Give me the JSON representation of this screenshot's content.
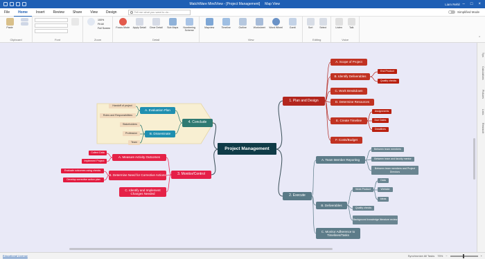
{
  "app": {
    "title": "MatchWare MindView - [Project Management]",
    "context_tab": "Map View",
    "user": "Liam Rehil",
    "search_placeholder": "Tell me what you want to do..."
  },
  "menu": {
    "tabs": [
      "File",
      "Home",
      "Insert",
      "Review",
      "Share",
      "View",
      "Design"
    ],
    "active": "Home",
    "simplified_mode": "Simplified Mode"
  },
  "ribbon": {
    "groups": [
      {
        "name": "Clipboard",
        "buttons": [
          "Paste"
        ]
      },
      {
        "name": "Font",
        "buttons": []
      },
      {
        "name": "Zoom",
        "buttons": [],
        "zoom_items": [
          "100%",
          "Fit All",
          "Full Screen"
        ]
      },
      {
        "name": "Detail",
        "buttons": [
          "Focus Mode",
          "Apply Detail",
          "Clear Detail",
          "Sub Maps",
          "Numbering Scheme"
        ]
      },
      {
        "name": "View",
        "buttons": [
          "Mapview",
          "Timeline",
          "Outline",
          "Worksheet",
          "Word Wheel",
          "Gantt"
        ]
      },
      {
        "name": "Editing",
        "buttons": [
          "Sort",
          "Select"
        ]
      },
      {
        "name": "Voice",
        "buttons": [
          "Listen",
          "Talk",
          "Voice"
        ]
      }
    ]
  },
  "side_panels": [
    "Tips",
    "Calculations",
    "Pictures",
    "Links",
    "Research"
  ],
  "status": {
    "left": "Educational License",
    "sync": "Synchronize All Tasks",
    "zoom": "75%"
  },
  "mindmap": {
    "root": "Project Management",
    "plan": {
      "label": "1. Plan and Design",
      "children": [
        "A. Scope of Project",
        "B. Identify Deliverables",
        "C. Work Breakdown",
        "D. Determine Resources",
        "E. Create Timeline",
        "F. Costs/Budget"
      ],
      "deliverables": [
        "End Product",
        "Quality checks"
      ],
      "timeline": [
        "Assignments",
        "Due Dates",
        "Deadlines"
      ]
    },
    "execute": {
      "label": "2. Execute",
      "children": [
        "A. Team Member Reporting",
        "B. Deliverables",
        "C. Monitor Adherence to Timelines/Tasks"
      ],
      "reporting": [
        "Between team members",
        "Between team and faculty mentor",
        "Between team members and Project Directors"
      ],
      "deliverables": [
        "Work Product",
        "Quality checks",
        "Background knowledge literature review"
      ],
      "work_product": [
        "Data",
        "Website",
        "Ideas"
      ]
    },
    "monitor": {
      "label": "3. Monitor/Control",
      "children": [
        "A. Measure Activity Outcomes",
        "B. Determine Need for Corrective Actions",
        "C. Identify and Implement Changes Needed"
      ],
      "measure": [
        "Collect Data",
        "Implement Project"
      ],
      "corrective": [
        "Evaluate outcomes using checks",
        "Develop corrective action plan"
      ]
    },
    "conclude": {
      "label": "4. Conclude",
      "children": [
        "A. Evaluation Plan",
        "B. Disseminate"
      ],
      "evaluation": [
        "Handoff of project",
        "Roles and Responsibilities"
      ],
      "disseminate": [
        "Stakeholders",
        "Profession",
        "Team"
      ]
    }
  }
}
